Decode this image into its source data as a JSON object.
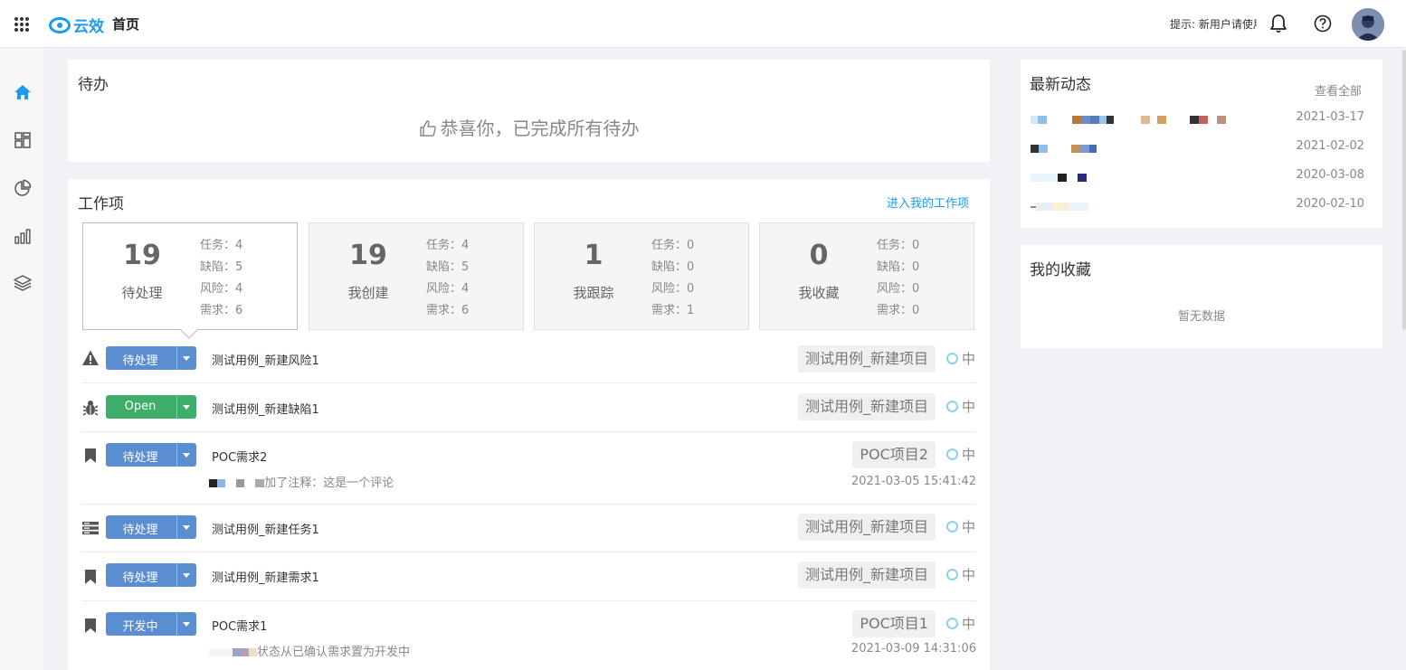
{
  "header": {
    "brand": "云效",
    "page_title": "首页",
    "hint": "提示: 新用户请使用"
  },
  "sidebar": {
    "items": [
      {
        "icon": "home-icon",
        "active": true
      },
      {
        "icon": "dashboard-icon",
        "active": false
      },
      {
        "icon": "pie-chart-icon",
        "active": false
      },
      {
        "icon": "bar-chart-icon",
        "active": false
      },
      {
        "icon": "layers-icon",
        "active": false
      }
    ]
  },
  "todo": {
    "title": "待办",
    "empty_text": "恭喜你，已完成所有待办"
  },
  "work": {
    "title": "工作项",
    "enter_link": "进入我的工作项",
    "stats": [
      {
        "count": "19",
        "label": "待处理",
        "task": "任务：4",
        "bug": "缺陷：5",
        "risk": "风险：4",
        "req": "需求：6"
      },
      {
        "count": "19",
        "label": "我创建",
        "task": "任务：4",
        "bug": "缺陷：5",
        "risk": "风险：4",
        "req": "需求：6"
      },
      {
        "count": "1",
        "label": "我跟踪",
        "task": "任务：0",
        "bug": "缺陷：0",
        "risk": "风险：0",
        "req": "需求：1"
      },
      {
        "count": "0",
        "label": "我收藏",
        "task": "任务：0",
        "bug": "缺陷：0",
        "risk": "风险：0",
        "req": "需求：0"
      }
    ],
    "items": [
      {
        "type_icon": "warning-icon",
        "status": "待处理",
        "status_color": "#5b8ed1",
        "title": "测试用例_新建风险1",
        "project": "测试用例_新建项目",
        "priority": "中"
      },
      {
        "type_icon": "bug-icon",
        "status": "Open",
        "status_color": "#3fae6b",
        "title": "测试用例_新建缺陷1",
        "project": "测试用例_新建项目",
        "priority": "中"
      },
      {
        "type_icon": "bookmark-icon",
        "status": "待处理",
        "status_color": "#5b8ed1",
        "title": "POC需求2",
        "project": "POC项目2",
        "priority": "中",
        "comment": "加了注释：这是一个评论",
        "time": "2021-03-05 15:41:42"
      },
      {
        "type_icon": "task-list-icon",
        "status": "待处理",
        "status_color": "#5b8ed1",
        "title": "测试用例_新建任务1",
        "project": "测试用例_新建项目",
        "priority": "中"
      },
      {
        "type_icon": "bookmark-icon",
        "status": "待处理",
        "status_color": "#5b8ed1",
        "title": "测试用例_新建需求1",
        "project": "测试用例_新建项目",
        "priority": "中"
      },
      {
        "type_icon": "bookmark-icon",
        "status": "开发中",
        "status_color": "#5b8ed1",
        "title": "POC需求1",
        "project": "POC项目1",
        "priority": "中",
        "comment": "状态从已确认需求置为开发中",
        "time": "2021-03-09 14:31:06"
      }
    ]
  },
  "news": {
    "title": "最新动态",
    "view_all": "查看全部",
    "items": [
      {
        "date": "2021-03-17"
      },
      {
        "date": "2021-02-02"
      },
      {
        "date": "2020-03-08"
      },
      {
        "date": "2020-02-10"
      }
    ]
  },
  "favorites": {
    "title": "我的收藏",
    "empty": "暂无数据"
  },
  "colors": {
    "brand": "#1b9aee",
    "status_blue": "#5b8ed1",
    "status_green": "#3fae6b"
  }
}
